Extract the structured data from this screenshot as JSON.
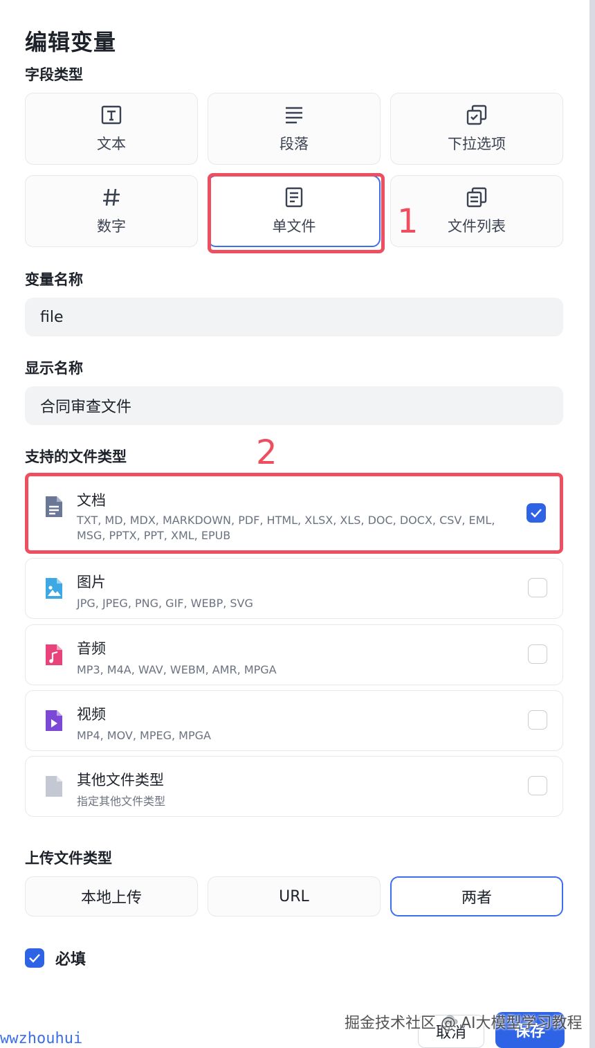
{
  "dialog": {
    "title": "编辑变量"
  },
  "field_type": {
    "label": "字段类型",
    "options": [
      {
        "label": "文本",
        "icon": "text-type-icon"
      },
      {
        "label": "段落",
        "icon": "paragraph-icon"
      },
      {
        "label": "下拉选项",
        "icon": "select-icon"
      },
      {
        "label": "数字",
        "icon": "hash-icon"
      },
      {
        "label": "单文件",
        "icon": "file-icon",
        "selected": true
      },
      {
        "label": "文件列表",
        "icon": "file-list-icon"
      }
    ]
  },
  "variable_name": {
    "label": "变量名称",
    "value": "file"
  },
  "display_name": {
    "label": "显示名称",
    "value": "合同审查文件"
  },
  "supported_types": {
    "label": "支持的文件类型",
    "items": [
      {
        "name": "文档",
        "extensions": "TXT, MD, MDX, MARKDOWN, PDF, HTML, XLSX, XLS, DOC, DOCX, CSV, EML, MSG, PPTX, PPT, XML, EPUB",
        "checked": true,
        "icon": "document-icon",
        "color": "#6b7796"
      },
      {
        "name": "图片",
        "extensions": "JPG, JPEG, PNG, GIF, WEBP, SVG",
        "checked": false,
        "icon": "image-icon",
        "color": "#3ea8e5"
      },
      {
        "name": "音频",
        "extensions": "MP3, M4A, WAV, WEBM, AMR, MPGA",
        "checked": false,
        "icon": "audio-icon",
        "color": "#e8437a"
      },
      {
        "name": "视频",
        "extensions": "MP4, MOV, MPEG, MPGA",
        "checked": false,
        "icon": "video-icon",
        "color": "#7b49d6"
      },
      {
        "name": "其他文件类型",
        "extensions": "指定其他文件类型",
        "checked": false,
        "icon": "other-file-icon",
        "color": "#c4c8d2"
      }
    ]
  },
  "upload_type": {
    "label": "上传文件类型",
    "options": [
      {
        "label": "本地上传",
        "selected": false
      },
      {
        "label": "URL",
        "selected": false
      },
      {
        "label": "两者",
        "selected": true
      }
    ]
  },
  "required": {
    "label": "必填",
    "checked": true
  },
  "footer": {
    "cancel_label": "取消",
    "save_label": "保存"
  },
  "annotations": {
    "marker_1": "1",
    "marker_2": "2",
    "color": "#ee4f60"
  },
  "watermark": {
    "text": "掘金技术社区 @ AI大模型学习教程",
    "corner_text": "wwzhouhui"
  },
  "colors": {
    "accent": "#2f63e6",
    "selected_border": "#3b6ef0"
  }
}
